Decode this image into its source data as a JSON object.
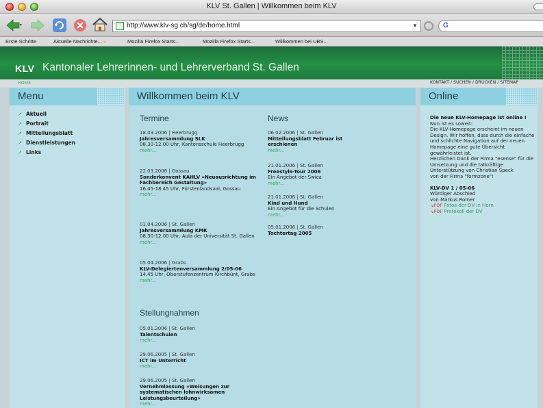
{
  "window": {
    "title": "KLV St. Gallen | Willkommen beim KLV"
  },
  "browser": {
    "url": "http://www.klv-sg.ch/sg/de/home.html",
    "search_placeholder": "G",
    "bookmarks": [
      "Erste Schritte",
      "Aktuelle Nachrichte...",
      "Mozilla Firefox Starts...",
      "Mozilla Firefox Starts...",
      "Willkommen bei UBS..."
    ]
  },
  "site": {
    "logo": "KLV",
    "org_name": "Kantonaler Lehrerinnen- und Lehrerverband St. Gallen",
    "home_link": "HOME",
    "util_links": "KONTAKT / SUCHEN / DRUCKEN / SITEMAP"
  },
  "menu": {
    "title": "Menu",
    "items": [
      "Aktuell",
      "Portrait",
      "Mitteilungsblatt",
      "Dienstleistungen",
      "Links"
    ]
  },
  "main": {
    "title": "Willkommen beim KLV",
    "termine": {
      "heading": "Termine",
      "entries": [
        {
          "meta": "18.03.2006 | Heerbrugg",
          "title": "Jahresversammlung SLK",
          "text": "08.30-12.00 Uhr, Kantonsschule Heerbrugg",
          "more": "mehr..."
        },
        {
          "meta": "22.03.2006 | Gossau",
          "title": "Sonderkonvent KAHLV «Neuausrichtung im Fachbereich Gestaltung»",
          "text": "16.45-18.45 Uhr, Fürstenlandsaal, Gossau",
          "more": "mehr..."
        },
        {
          "meta": "01.04.2006 | St. Gallen",
          "title": "Jahresversammlung KMK",
          "text": "08.30-12.00 Uhr, Aula der Universität St. Gallen",
          "more": "mehr..."
        },
        {
          "meta": "05.04.2006 | Grabs",
          "title": "KLV-Delegiertenversammlung 2/05-06",
          "text": "14.45 Uhr, Oberstufenzentrum Kirchbünt, Grabs",
          "more": "mehr..."
        }
      ]
    },
    "news": {
      "heading": "News",
      "entries": [
        {
          "meta": "06.02.2006 | St. Gallen",
          "title": "Mitteilungsblatt Februar ist erschienen",
          "text": "",
          "more": "mehr..."
        },
        {
          "meta": "21.01.2006 | St. Gallen",
          "title": "Freestyle-Tour 2006",
          "text": "Ein Angebot der Swica",
          "more": "mehr..."
        },
        {
          "meta": "21.01.2006 | St. Gallen",
          "title": "Kind und Hund",
          "text": "Ein Angebot für die Schulen",
          "more": "mehr..."
        },
        {
          "meta": "05.01.2006 | St. Gallen",
          "title": "Tochtertag 2005",
          "text": "",
          "more": "mehr..."
        }
      ]
    },
    "stellungnahmen": {
      "heading": "Stellungnahmen",
      "entries": [
        {
          "meta": "05.01.2006 | St. Gallen",
          "title": "Talentschulen",
          "more": "mehr..."
        },
        {
          "meta": "29.06.2005 | St. Gallen",
          "title": "ICT im Unterricht",
          "more": "mehr..."
        },
        {
          "meta": "29.06.2005 | St. Gallen",
          "title": "Vernehmlassung «Weisungen zur systematischen lohnwirksamen Leistungsbeurteilung»",
          "more": "mehr..."
        }
      ]
    }
  },
  "online": {
    "title": "Online",
    "headline": "Die neue KLV-Homepage ist online !",
    "lines": [
      "Nun ist es soweit:",
      "Die KLV-Homepage erscheint im neuen Design. Wir hoffen, dass durch die einfache und schlichte Navigation auf der neuen Homepage eine gute Übersicht gewährleistet ist.",
      "Herzlichen Dank der Firma \"esense\" für die Umsetzung und die tatkräftige Unterstützung von Christian Speck",
      "von der Firma \"formzone\"!"
    ],
    "dv_title": "KLV-DV 1 / 05-06",
    "dv_text1": "Würdiger Abschied",
    "dv_text2": "von Markus Romer",
    "pdf_tag": "PDF",
    "pdf_links": [
      "Fotos der DV in Horn",
      "Protokoll der DV"
    ]
  }
}
